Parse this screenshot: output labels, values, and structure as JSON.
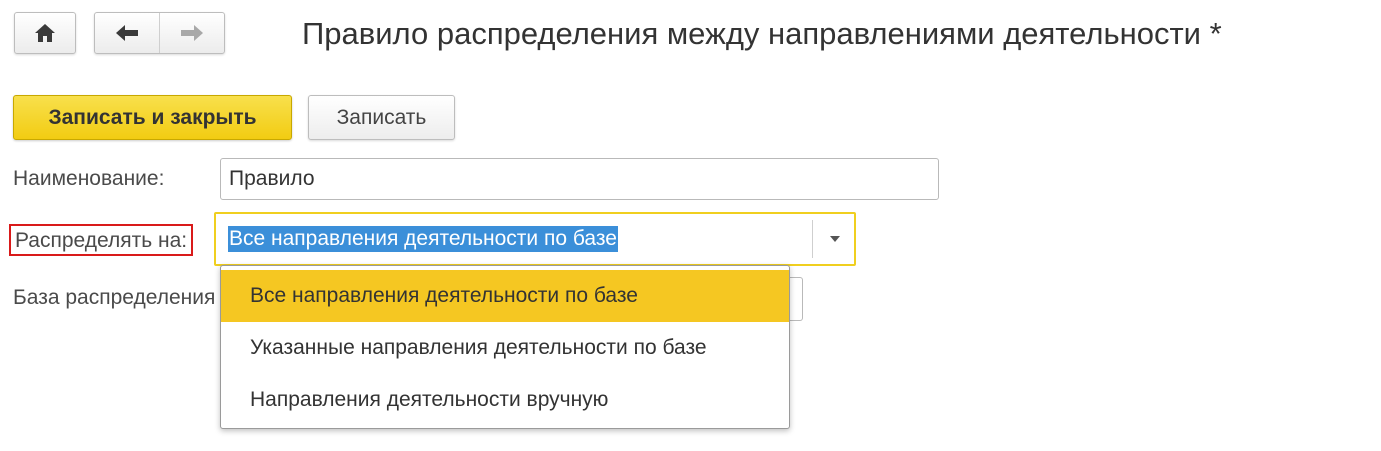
{
  "header": {
    "title": "Правило распределения между направлениями деятельности *",
    "home_icon": "home-icon",
    "back_icon": "arrow-left-icon",
    "forward_icon": "arrow-right-icon"
  },
  "toolbar": {
    "save_close_label": "Записать и закрыть",
    "save_label": "Записать"
  },
  "form": {
    "name_label": "Наименование:",
    "name_value": "Правило",
    "distribute_label": "Распределять на:",
    "distribute_value": "Все направления деятельности по базе",
    "base_label": "База распределения"
  },
  "dropdown": {
    "items": [
      {
        "label": "Все направления деятельности по базе",
        "selected": true
      },
      {
        "label": "Указанные направления деятельности по базе",
        "selected": false
      },
      {
        "label": "Направления деятельности вручную",
        "selected": false
      }
    ]
  },
  "colors": {
    "primary_button": "#f2cc12",
    "selection_highlight": "#3b8fd9",
    "focus_border": "#f0cf1f",
    "active_item": "#f5c722",
    "annotation_red": "#d91a1a"
  }
}
